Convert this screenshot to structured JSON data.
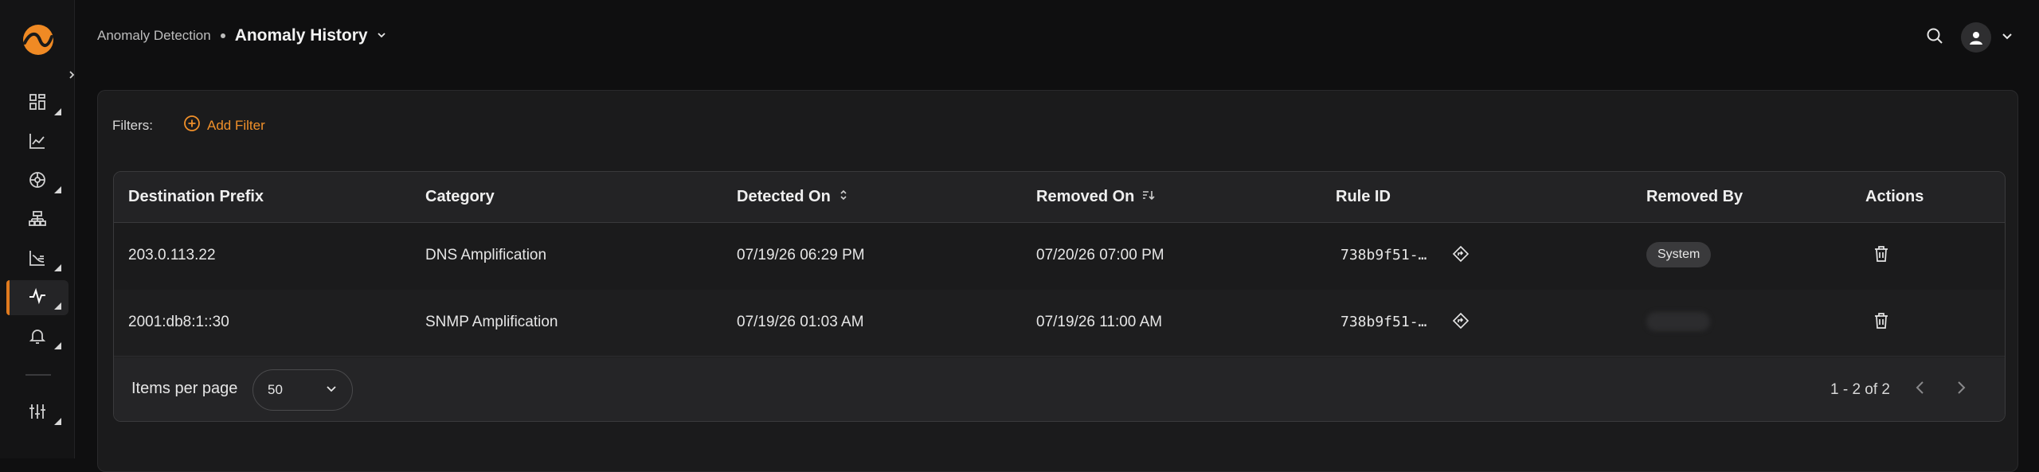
{
  "colors": {
    "accent": "#e07a1e",
    "background": "#0f0f10",
    "panel": "#1b1b1c"
  },
  "sidebar": {
    "items": [
      {
        "name": "dashboards",
        "icon": "grid-icon"
      },
      {
        "name": "analytics",
        "icon": "line-chart-icon"
      },
      {
        "name": "network",
        "icon": "globe-icon"
      },
      {
        "name": "topology",
        "icon": "hierarchy-icon"
      },
      {
        "name": "reports",
        "icon": "chart-axis-icon"
      },
      {
        "name": "anomaly",
        "icon": "pulse-icon",
        "active": true
      },
      {
        "name": "alerts",
        "icon": "bell-icon"
      },
      {
        "name": "settings",
        "icon": "sliders-icon"
      }
    ]
  },
  "header": {
    "breadcrumb_parent": "Anomaly Detection",
    "title": "Anomaly History"
  },
  "filters": {
    "label": "Filters:",
    "add_label": "Add Filter"
  },
  "table": {
    "columns": [
      "Destination Prefix",
      "Category",
      "Detected On",
      "Removed On",
      "Rule ID",
      "Removed By",
      "Actions"
    ],
    "rows": [
      {
        "prefix": "203.0.113.22",
        "category": "DNS Amplification",
        "detected": "07/19/26 06:29 PM",
        "removed": "07/20/26 07:00 PM",
        "rule_id": "738b9f51-…",
        "removed_by": "System"
      },
      {
        "prefix": "2001:db8:1::30",
        "category": "SNMP Amplification",
        "detected": "07/19/26 01:03 AM",
        "removed": "07/19/26 11:00 AM",
        "rule_id": "738b9f51-…",
        "removed_by": ""
      }
    ]
  },
  "pagination": {
    "items_per_page_label": "Items per page",
    "items_per_page_value": "50",
    "range_text": "1 - 2 of 2"
  }
}
